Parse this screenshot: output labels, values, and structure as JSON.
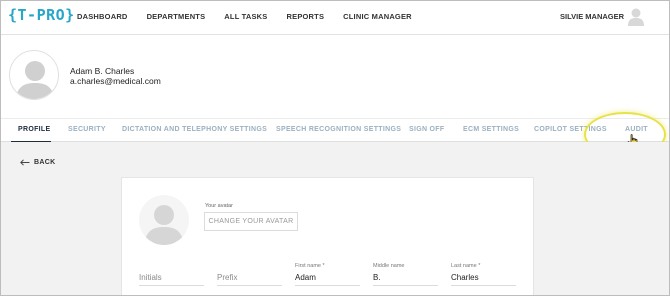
{
  "app": {
    "logo": "{T-PRO}"
  },
  "nav": {
    "items": [
      "DASHBOARD",
      "DEPARTMENTS",
      "ALL TASKS",
      "REPORTS",
      "CLINIC MANAGER"
    ],
    "user_name": "SILVIE MANAGER"
  },
  "profile": {
    "name": "Adam B. Charles",
    "email": "a.charles@medical.com"
  },
  "tabs": [
    {
      "label": "PROFILE",
      "active": true
    },
    {
      "label": "SECURITY",
      "active": false
    },
    {
      "label": "DICTATION AND TELEPHONY SETTINGS",
      "active": false
    },
    {
      "label": "SPEECH RECOGNITION SETTINGS",
      "active": false
    },
    {
      "label": "SIGN OFF",
      "active": false
    },
    {
      "label": "ECM SETTINGS",
      "active": false
    },
    {
      "label": "COPILOT SETTINGS",
      "active": false
    },
    {
      "label": "AUDIT",
      "active": false
    }
  ],
  "back_label": "BACK",
  "avatar_section": {
    "caption": "Your avatar",
    "change_label": "CHANGE YOUR AVATAR"
  },
  "form": {
    "initials": {
      "placeholder": "Initials",
      "value": ""
    },
    "prefix": {
      "placeholder": "Prefix",
      "value": ""
    },
    "first_name": {
      "label": "First name *",
      "value": "Adam"
    },
    "middle_name": {
      "label": "Middle name",
      "value": "B."
    },
    "last_name": {
      "label": "Last name *",
      "value": "Charles"
    }
  },
  "colors": {
    "brand": "#27a6c9",
    "tab_inactive": "#9bb0c0",
    "tab_active": "#1f2d3d",
    "highlight": "#e8e24a"
  }
}
